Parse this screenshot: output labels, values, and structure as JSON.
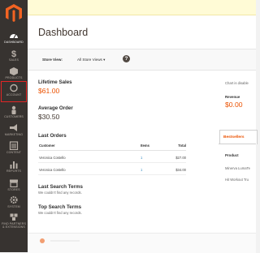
{
  "sidebar": {
    "items": [
      {
        "id": "dashboard",
        "label": "DASHBOARD",
        "icon": "dashboard-icon"
      },
      {
        "id": "sales",
        "label": "SALES",
        "icon": "dollar-icon"
      },
      {
        "id": "products",
        "label": "PRODUCTS",
        "icon": "cube-icon"
      },
      {
        "id": "account",
        "label": "ACCOUNT",
        "icon": "circle-icon"
      },
      {
        "id": "customers",
        "label": "CUSTOMERS",
        "icon": "person-icon"
      },
      {
        "id": "marketing",
        "label": "MARKETING",
        "icon": "megaphone-icon"
      },
      {
        "id": "content",
        "label": "CONTENT",
        "icon": "layout-icon"
      },
      {
        "id": "reports",
        "label": "REPORTS",
        "icon": "bar-chart-icon"
      },
      {
        "id": "stores",
        "label": "STORES",
        "icon": "store-icon"
      },
      {
        "id": "system",
        "label": "SYSTEM",
        "icon": "gear-icon"
      },
      {
        "id": "extensions",
        "label": "FIND PARTNERS & EXTENSIONS",
        "icon": "blocks-icon"
      }
    ]
  },
  "header": {
    "title": "Dashboard"
  },
  "scope": {
    "label": "Store View:",
    "value": "All Store Views"
  },
  "lifetime_sales": {
    "label": "Lifetime Sales",
    "value": "$61.00"
  },
  "average_order": {
    "label": "Average Order",
    "value": "$30.50"
  },
  "chart_notice": "Chart is disable",
  "revenue": {
    "label": "Revenue",
    "value": "$0.00"
  },
  "last_orders": {
    "title": "Last Orders",
    "columns": [
      "Customer",
      "Items",
      "Total"
    ],
    "rows": [
      {
        "customer": "Veronica Costello",
        "items": "1",
        "total": "$27.00"
      },
      {
        "customer": "Veronica Costello",
        "items": "1",
        "total": "$34.00"
      }
    ]
  },
  "tabs": {
    "active": "Bestsellers"
  },
  "bestsellers": {
    "header": "Product",
    "items": [
      "Minerva LumaTe",
      "Hit Workout Tru"
    ]
  },
  "last_search": {
    "title": "Last Search Terms",
    "empty": "We couldn't find any records."
  },
  "top_search": {
    "title": "Top Search Terms",
    "empty": "We couldn't find any records."
  }
}
